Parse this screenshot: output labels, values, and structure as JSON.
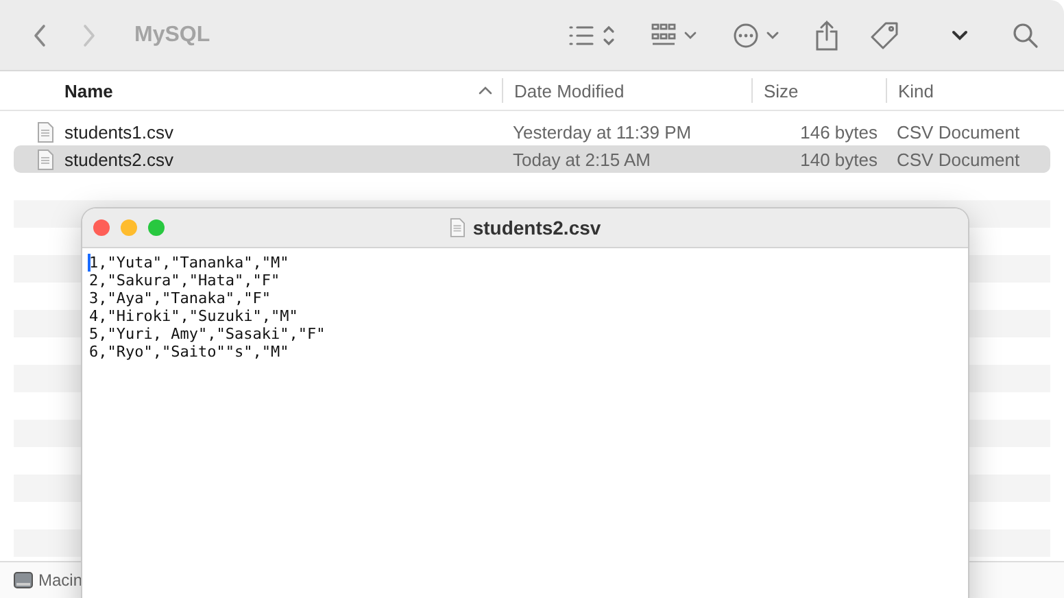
{
  "finder": {
    "nav": [
      {
        "kind": "back",
        "disabled": false
      },
      {
        "kind": "forward",
        "disabled": true
      }
    ],
    "title": "MySQL",
    "columns": [
      {
        "label": "Name",
        "sorted": true
      },
      {
        "label": "Date Modified",
        "sorted": false
      },
      {
        "label": "Size",
        "sorted": false
      },
      {
        "label": "Kind",
        "sorted": false
      }
    ],
    "files": [
      {
        "name": "students1.csv",
        "date": "Yesterday at 11:39 PM",
        "size": "146 bytes",
        "kind": "CSV Document",
        "selected": false
      },
      {
        "name": "students2.csv",
        "date": "Today at 2:15 AM",
        "size": "140 bytes",
        "kind": "CSV Document",
        "selected": true
      }
    ],
    "path_bar": "Macin"
  },
  "editor": {
    "title": "students2.csv",
    "lines": [
      "1,\"Yuta\",\"Tananka\",\"M\"",
      "2,\"Sakura\",\"Hata\",\"F\"",
      "3,\"Aya\",\"Tanaka\",\"F\"",
      "4,\"Hiroki\",\"Suzuki\",\"M\"",
      "5,\"Yuri, Amy\",\"Sasaki\",\"F\"",
      "6,\"Ryo\",\"Saito\"\"s\",\"M\""
    ]
  }
}
